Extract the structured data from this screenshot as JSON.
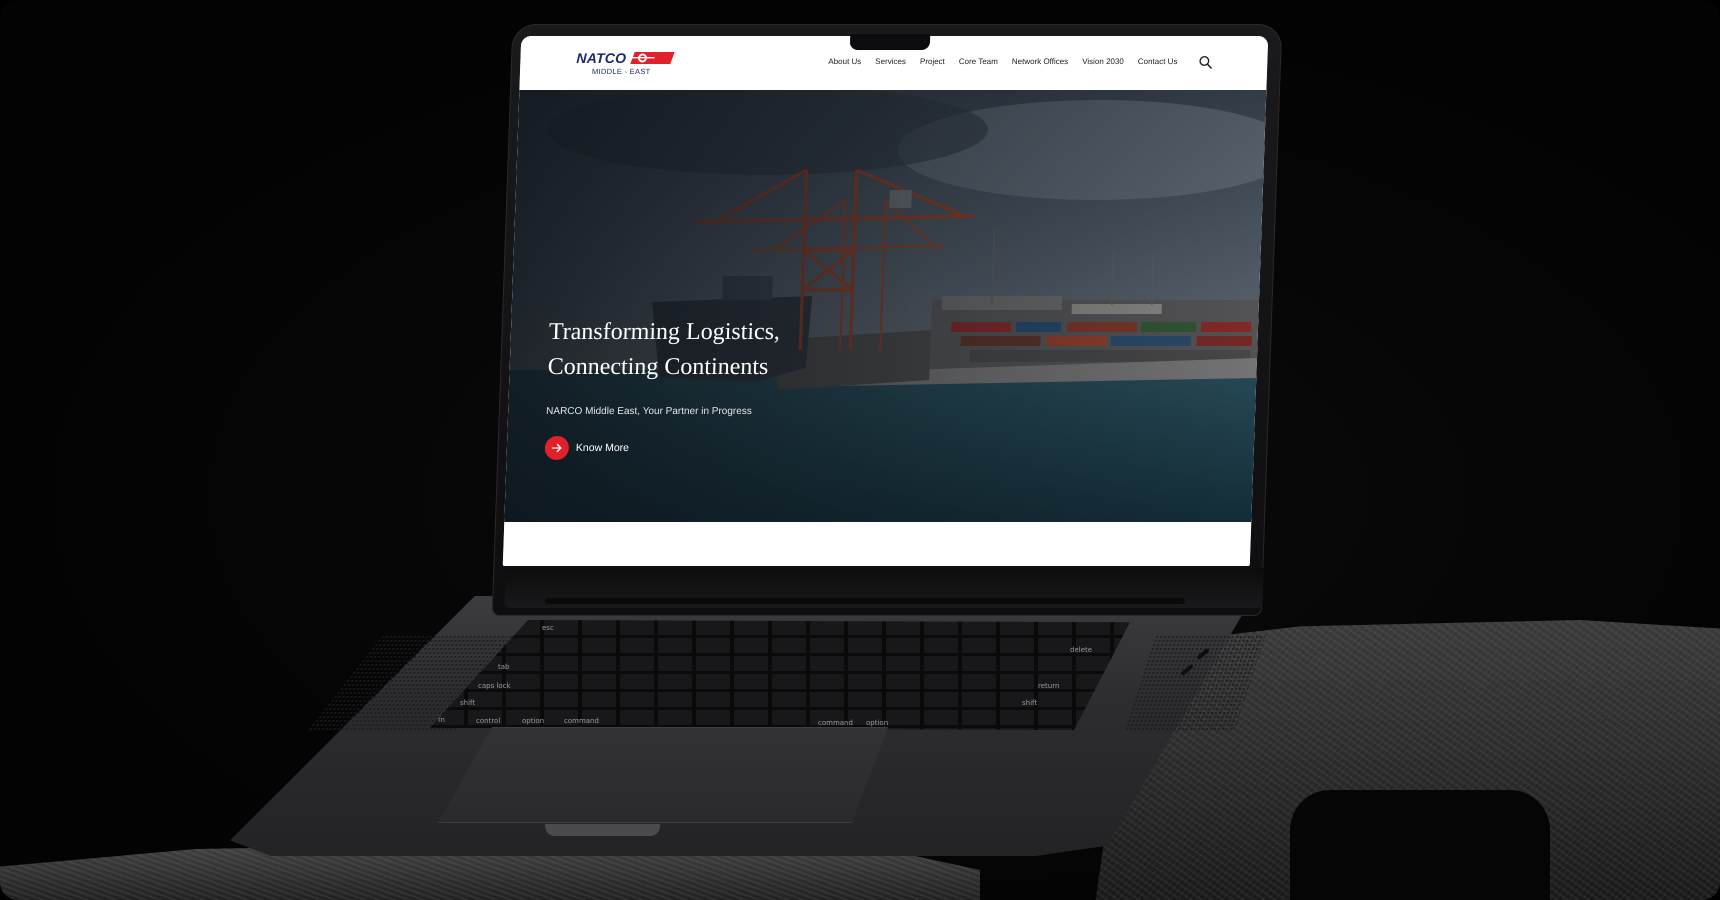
{
  "site": {
    "logo": {
      "name": "NATCO",
      "sub": "MIDDLE - EAST",
      "brand_color": "#1b2a6b",
      "accent_color": "#e02129"
    },
    "nav": [
      "About Us",
      "Services",
      "Project",
      "Core Team",
      "Network Offices",
      "Vision 2030",
      "Contact Us"
    ],
    "search_icon": "search-icon"
  },
  "hero": {
    "title_line1": "Transforming Logistics,",
    "title_line2": "Connecting Continents",
    "subtitle": "NARCO Middle East, Your Partner in Progress",
    "cta": {
      "label": "Know More",
      "icon": "arrow-right-icon",
      "color": "#e02129"
    },
    "image": "container-port-cranes"
  },
  "keyboard": {
    "labels": [
      "esc",
      "tab",
      "caps lock",
      "shift",
      "fn",
      "control",
      "option",
      "command",
      "delete",
      "return",
      "shift",
      "command",
      "option"
    ]
  }
}
